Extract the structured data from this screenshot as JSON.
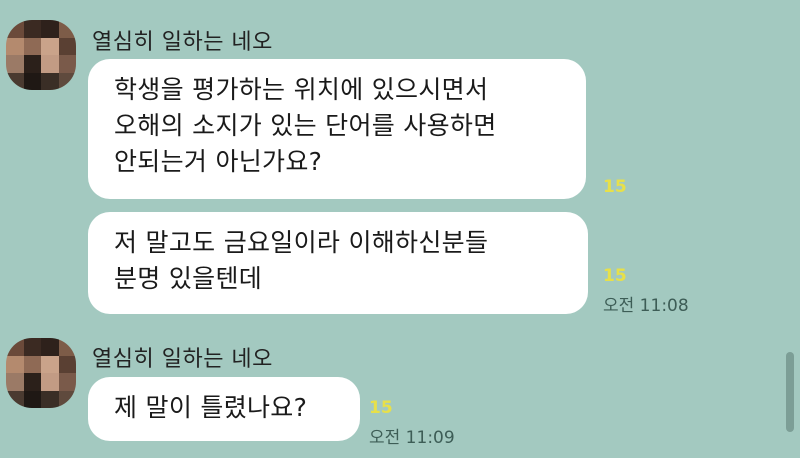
{
  "messages_group_1": {
    "sender": "열심히 일하는 네오",
    "bubble1": {
      "lines": [
        "학생을 평가하는 위치에 있으시면서",
        "오해의 소지가 있는 단어를 사용하면",
        "안되는거 아닌가요?"
      ],
      "unread": "15"
    },
    "bubble2": {
      "lines": [
        "저 말고도 금요일이라 이해하신분들",
        "분명 있을텐데"
      ],
      "unread": "15",
      "time": "오전 11:08"
    }
  },
  "messages_group_2": {
    "sender": "열심히 일하는 네오",
    "bubble1": {
      "lines": [
        "제 말이 틀렸나요?"
      ],
      "unread": "15",
      "time": "오전 11:09"
    }
  },
  "colors": {
    "background": "#a3c9c0",
    "bubble": "#ffffff",
    "unread": "#e7e04a"
  }
}
